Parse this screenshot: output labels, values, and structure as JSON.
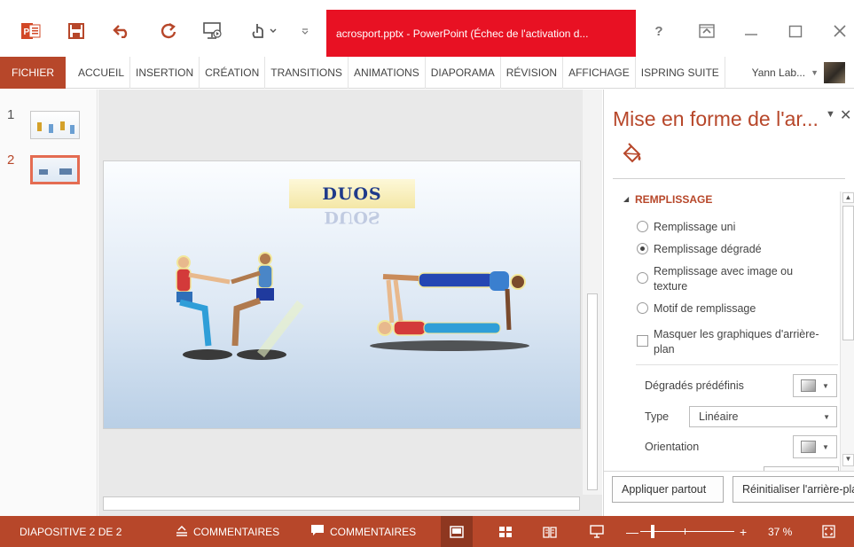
{
  "window": {
    "title": "acrosport.pptx - PowerPoint (Échec de l'activation d...",
    "help": "?",
    "icons": [
      "powerpoint-logo",
      "save",
      "undo",
      "redo",
      "from-beginning",
      "touch-mode",
      "customize-qat"
    ]
  },
  "ribbon": {
    "file_tab": "FICHIER",
    "tabs": [
      "ACCUEIL",
      "INSERTION",
      "CRÉATION",
      "TRANSITIONS",
      "ANIMATIONS",
      "DIAPORAMA",
      "RÉVISION",
      "AFFICHAGE",
      "ISPRING SUITE"
    ],
    "user_name": "Yann Lab..."
  },
  "thumbnails": [
    {
      "number": "1",
      "selected": false
    },
    {
      "number": "2",
      "selected": true
    }
  ],
  "slide": {
    "title": "DUOS",
    "background": "blue-gradient"
  },
  "format_pane": {
    "title": "Mise en forme de l'ar...",
    "section_title": "REMPLISSAGE",
    "options": [
      {
        "type": "radio",
        "label": "Remplissage uni",
        "checked": false
      },
      {
        "type": "radio",
        "label": "Remplissage dégradé",
        "checked": true
      },
      {
        "type": "radio",
        "label": "Remplissage avec image ou texture",
        "checked": false
      },
      {
        "type": "radio",
        "label": "Motif de remplissage",
        "checked": false
      },
      {
        "type": "checkbox",
        "label": "Masquer les graphiques d'arrière-plan",
        "checked": false
      }
    ],
    "preset_label": "Dégradés prédéfinis",
    "type_label": "Type",
    "type_value": "Linéaire",
    "orientation_label": "Orientation",
    "apply_all": "Appliquer partout",
    "reset_background": "Réinitialiser l'arrière-plan"
  },
  "status_bar": {
    "slide_indicator": "DIAPOSITIVE 2 DE 2",
    "notes": "COMMENTAIRES",
    "comments": "COMMENTAIRES",
    "zoom_percent": "37 %",
    "zoom_level": 0.37
  },
  "colors": {
    "accent": "#B7472A",
    "title_tab": "#E81123",
    "status_bar": "#B7472A",
    "active_view": "#8E3720"
  }
}
